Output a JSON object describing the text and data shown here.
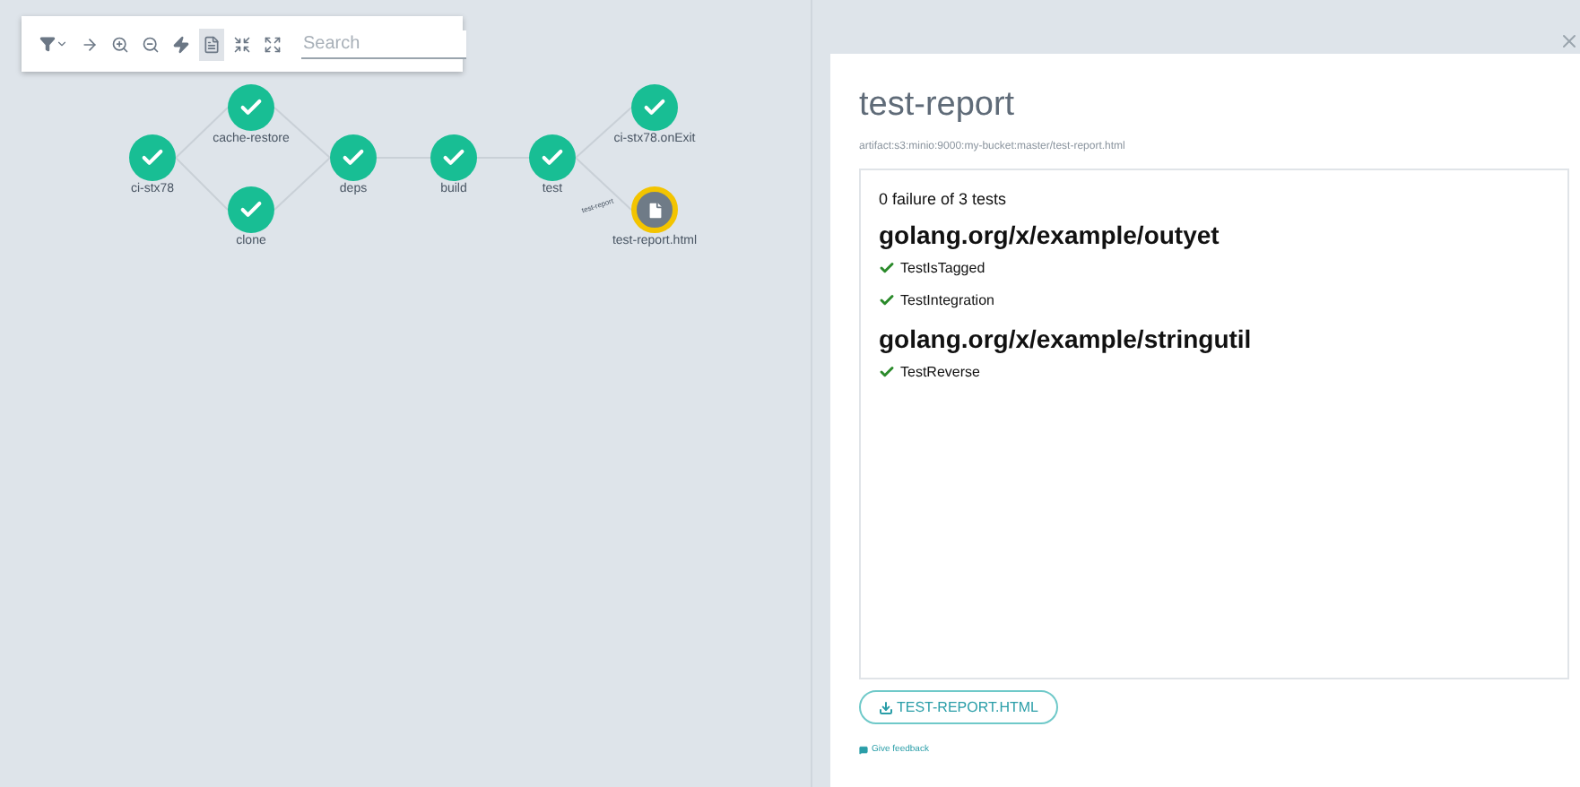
{
  "toolbar": {
    "tools": [
      {
        "kind": "filter",
        "selected": false
      },
      {
        "kind": "direction",
        "selected": false
      },
      {
        "kind": "zoom-in",
        "selected": false
      },
      {
        "kind": "zoom-out",
        "selected": false
      },
      {
        "kind": "bolt",
        "selected": false
      },
      {
        "kind": "artifacts",
        "selected": true
      },
      {
        "kind": "collapse",
        "selected": false
      },
      {
        "kind": "expand",
        "selected": false
      }
    ],
    "search": {
      "placeholder": "Search"
    }
  },
  "graph": {
    "nodes": [
      {
        "label": "ci-stx78",
        "kind": "pod",
        "selected": false
      },
      {
        "label": "cache-restore",
        "kind": "pod",
        "selected": false
      },
      {
        "label": "clone",
        "kind": "pod",
        "selected": false
      },
      {
        "label": "deps",
        "kind": "pod",
        "selected": false
      },
      {
        "label": "build",
        "kind": "pod",
        "selected": false
      },
      {
        "label": "test",
        "kind": "pod",
        "selected": false
      },
      {
        "label": "ci-stx78.onExit",
        "kind": "pod",
        "selected": false
      },
      {
        "label": "test-report.html",
        "kind": "artifact",
        "selected": true
      }
    ],
    "edge_label": "test-report"
  },
  "panel": {
    "title": "test-report",
    "path": "artifact:s3:minio:9000:my-bucket:master/test-report.html",
    "report": {
      "summary": "0 failure of 3 tests",
      "sections": [
        {
          "heading": "golang.org/x/example/outyet",
          "tests": [
            {
              "name": "TestIsTagged",
              "passed": true
            },
            {
              "name": "TestIntegration",
              "passed": true
            }
          ]
        },
        {
          "heading": "golang.org/x/example/stringutil",
          "tests": [
            {
              "name": "TestReverse",
              "passed": true
            }
          ]
        }
      ]
    },
    "download": "TEST-REPORT.HTML",
    "feedback": "Give feedback"
  }
}
